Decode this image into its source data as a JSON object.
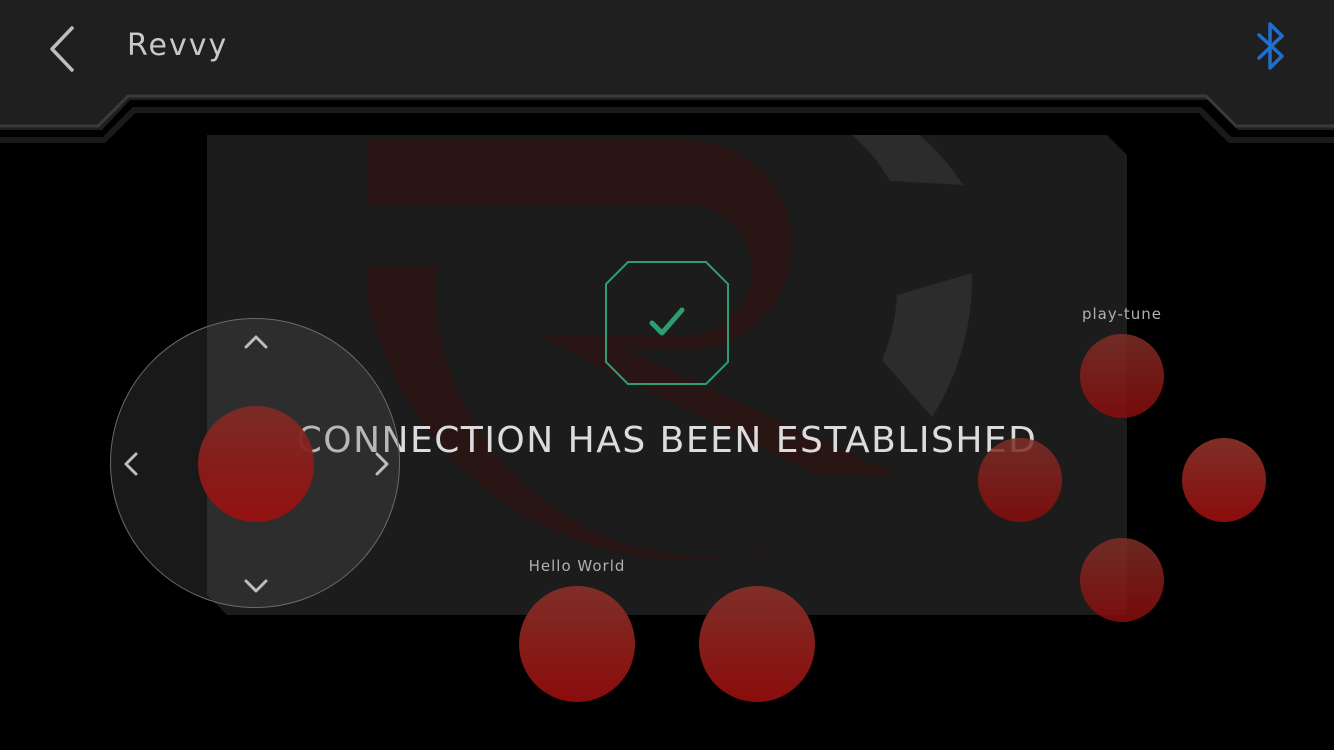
{
  "header": {
    "title": "Revvy",
    "back_icon": "chevron-left-icon",
    "bluetooth_icon": "bluetooth-icon",
    "bluetooth_color": "#1e6fd0"
  },
  "dialog": {
    "message": "CONNECTION HAS BEEN ESTABLISHED",
    "status_icon": "check-icon",
    "accent_color": "#2e9e6e"
  },
  "controls": {
    "joystick_icons": [
      "chevron-up-icon",
      "chevron-down-icon",
      "chevron-left-icon",
      "chevron-right-icon"
    ],
    "button_color": "#8a0c0c",
    "bottom_left_label": "Hello World",
    "top_right_label": "play-tune"
  }
}
